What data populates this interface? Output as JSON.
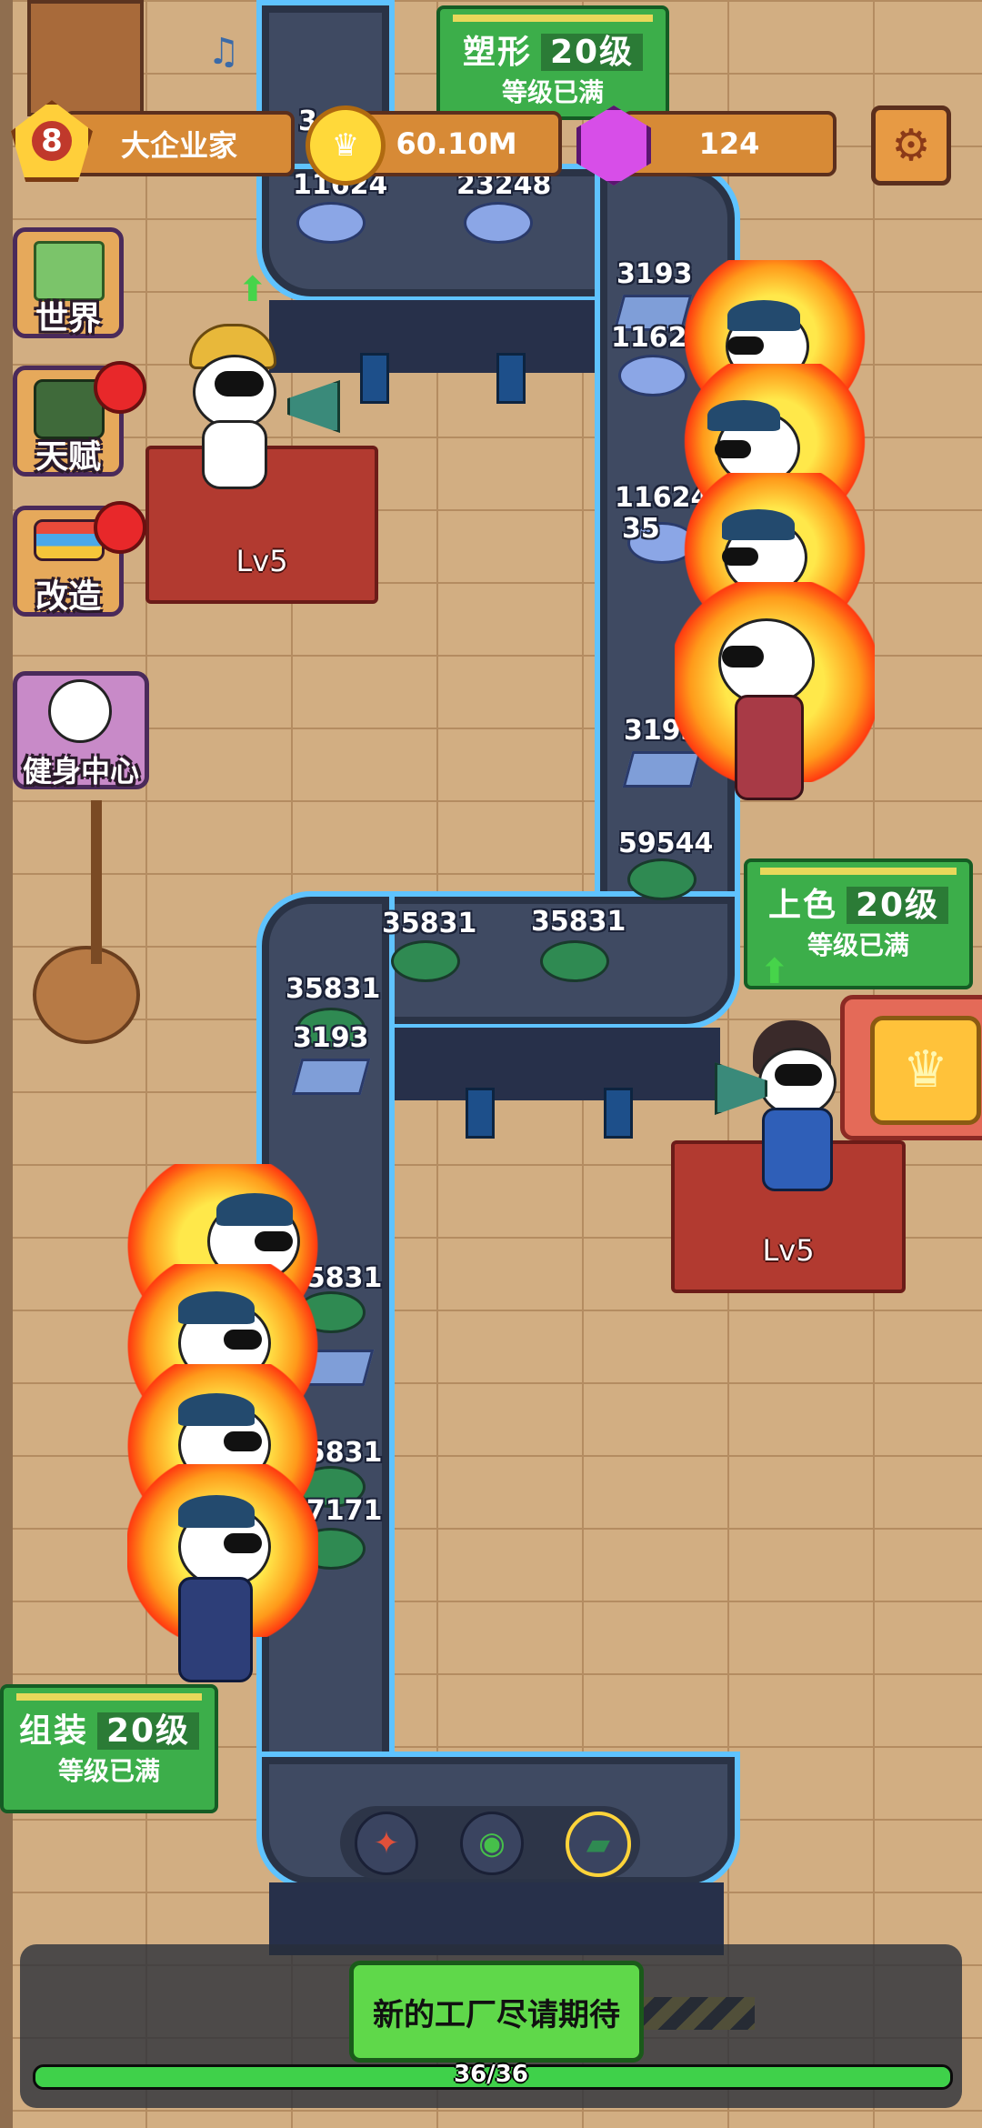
{
  "hud": {
    "player_level": "8",
    "player_title": "大企业家",
    "coins": "60.10M",
    "gems": "124",
    "settings_icon": "gear-icon"
  },
  "side_menu": [
    {
      "label": "世界",
      "icon": "map-icon",
      "has_alert": false
    },
    {
      "label": "天赋",
      "icon": "talent-icon",
      "has_alert": true
    },
    {
      "label": "改造",
      "icon": "remodel-icon",
      "has_alert": true
    },
    {
      "label": "健身中心",
      "icon": "gym-icon",
      "has_alert": false
    }
  ],
  "stations": {
    "molding": {
      "name": "塑形",
      "level": "20级",
      "status": "等级已满"
    },
    "coloring": {
      "name": "上色",
      "level": "20级",
      "status": "等级已满"
    },
    "assembly": {
      "name": "组装",
      "level": "20级",
      "status": "等级已满"
    }
  },
  "supervisors": [
    {
      "level_label": "Lv5"
    },
    {
      "level_label": "Lv5"
    }
  ],
  "belt_items": {
    "top_a": "11624",
    "top_b": "23248",
    "top_partial": "3",
    "right_1": "3193",
    "right_2": "11624",
    "right_3": "11624",
    "right_partial": "35",
    "right_4": "3193",
    "right_5": "59544",
    "mid_1": "35831",
    "mid_2": "35831",
    "mid_3": "35831",
    "mid_4": "3193",
    "left_1": "35831",
    "left_2": "35831",
    "left_3": "87171"
  },
  "bottom": {
    "status_button": "新的工厂尽请期待",
    "progress_text": "36/36",
    "progress_fraction": 1.0
  },
  "colors": {
    "belt": "#3f4a62",
    "belt_glow": "#5fc3ff",
    "sign_green": "#3cae4a",
    "platform_red": "#b23a30"
  }
}
